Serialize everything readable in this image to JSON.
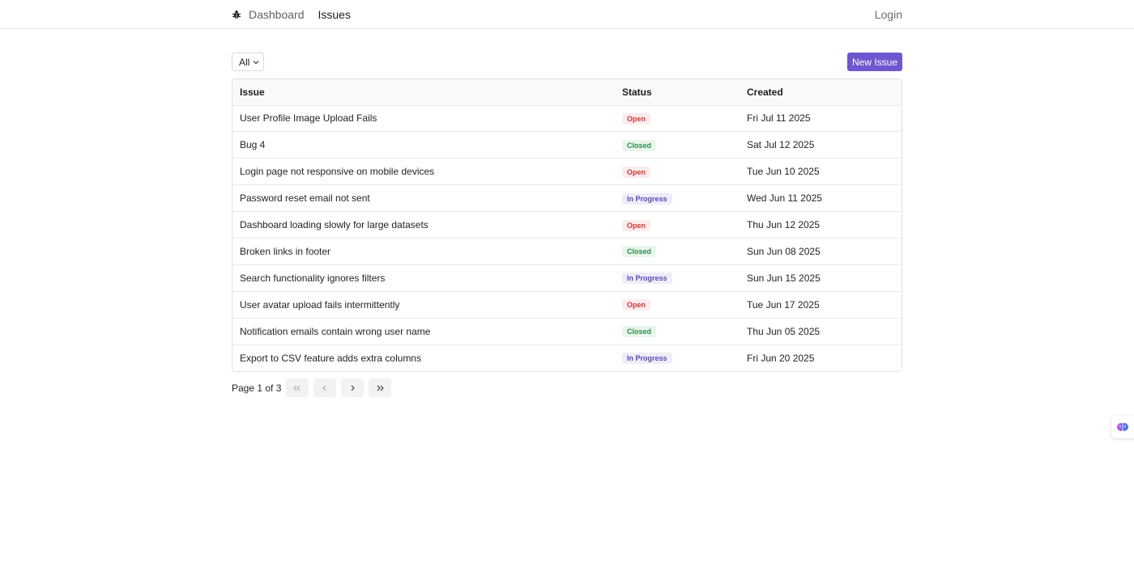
{
  "nav": {
    "logo_icon": "bug-icon",
    "links": [
      "Dashboard",
      "Issues"
    ],
    "login": "Login"
  },
  "toolbar": {
    "filter_value": "All",
    "new_issue_label": "New Issue"
  },
  "table": {
    "headers": [
      "Issue",
      "Status",
      "Created"
    ],
    "rows": [
      {
        "issue": "User Profile Image Upload Fails",
        "status": "Open",
        "created": "Fri Jul 11 2025"
      },
      {
        "issue": "Bug 4",
        "status": "Closed",
        "created": "Sat Jul 12 2025"
      },
      {
        "issue": "Login page not responsive on mobile devices",
        "status": "Open",
        "created": "Tue Jun 10 2025"
      },
      {
        "issue": "Password reset email not sent",
        "status": "In Progress",
        "created": "Wed Jun 11 2025"
      },
      {
        "issue": "Dashboard loading slowly for large datasets",
        "status": "Open",
        "created": "Thu Jun 12 2025"
      },
      {
        "issue": "Broken links in footer",
        "status": "Closed",
        "created": "Sun Jun 08 2025"
      },
      {
        "issue": "Search functionality ignores filters",
        "status": "In Progress",
        "created": "Sun Jun 15 2025"
      },
      {
        "issue": "User avatar upload fails intermittently",
        "status": "Open",
        "created": "Tue Jun 17 2025"
      },
      {
        "issue": "Notification emails contain wrong user name",
        "status": "Closed",
        "created": "Thu Jun 05 2025"
      },
      {
        "issue": "Export to CSV feature adds extra columns",
        "status": "In Progress",
        "created": "Fri Jun 20 2025"
      }
    ]
  },
  "pagination": {
    "label": "Page 1 of 3",
    "first": "«",
    "prev": "‹",
    "next": "›",
    "last": "»"
  },
  "colors": {
    "accent": "#6e56cf",
    "open": "#c93a3a",
    "closed": "#2f8a4b",
    "in_progress": "#5b49b8"
  }
}
